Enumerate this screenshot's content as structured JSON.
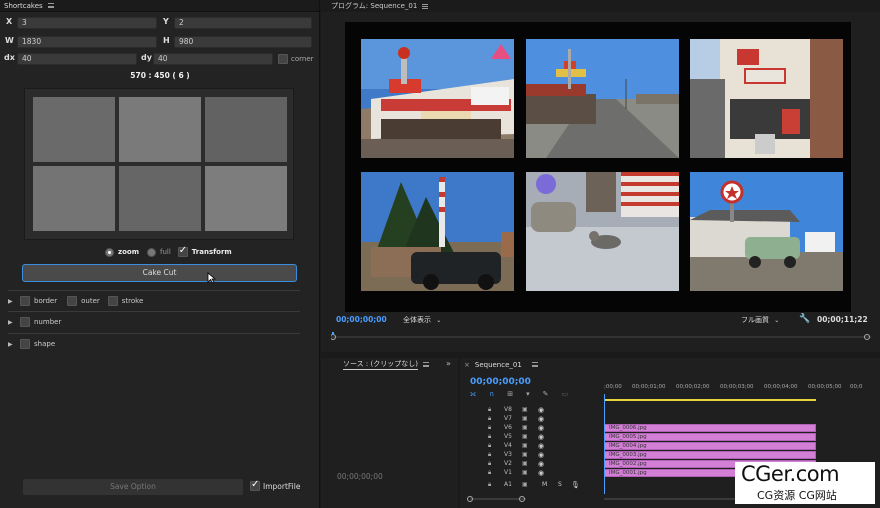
{
  "left_panel": {
    "title": "Shortcakes",
    "x_label": "X",
    "x_value": "3",
    "y_label": "Y",
    "y_value": "2",
    "w_label": "W",
    "w_value": "1830",
    "h_label": "H",
    "h_value": "980",
    "dx_label": "dx",
    "dx_value": "40",
    "dy_label": "dy",
    "dy_value": "40",
    "corner_label": "corner",
    "ratio": "570 : 450 ( 6 )",
    "zoom_label": "zoom",
    "full_label": "full",
    "transform_label": "Transform",
    "cake_cut_label": "Cake Cut",
    "sections": {
      "border": "border",
      "outer": "outer",
      "stroke": "stroke",
      "number": "number",
      "shape": "shape"
    },
    "save_option_label": "Save Option",
    "import_file_label": "ImportFile"
  },
  "program_monitor": {
    "title": "プログラム: Sequence_01",
    "timecode_current": "00;00;00;00",
    "zoom_dropdown": "全体表示",
    "quality_dropdown": "フル画質",
    "timecode_duration": "00;00;11;22"
  },
  "source_panel": {
    "title": "ソース : (クリップなし)",
    "timecode": "00;00;00;00"
  },
  "timeline": {
    "sequence_name": "Sequence_01",
    "timecode": "00;00;00;00",
    "ruler": [
      ";00;00",
      "00;00;01;00",
      "00;00;02;00",
      "00;00;03;00",
      "00;00;04;00",
      "00;00;05;00",
      "00;0"
    ],
    "tracks": [
      {
        "label": "V8",
        "clip": ""
      },
      {
        "label": "V7",
        "clip": ""
      },
      {
        "label": "V6",
        "clip": "IMG_0006.jpg"
      },
      {
        "label": "V5",
        "clip": "IMG_0005.jpg"
      },
      {
        "label": "V4",
        "clip": "IMG_0004.jpg"
      },
      {
        "label": "V3",
        "clip": "IMG_0003.jpg"
      },
      {
        "label": "V2",
        "clip": "IMG_0002.jpg"
      },
      {
        "label": "V1",
        "clip": "IMG_0001.jpg"
      },
      {
        "label": "A1",
        "clip": ""
      }
    ],
    "audio_m": "M",
    "audio_s": "S"
  },
  "watermark": {
    "big": "CGer.com",
    "small": "CG资源 CG网站"
  },
  "colors": {
    "accent_blue": "#4a9eff",
    "clip_pink": "#d37fd6",
    "playhead_yellow": "#e6d23a"
  }
}
